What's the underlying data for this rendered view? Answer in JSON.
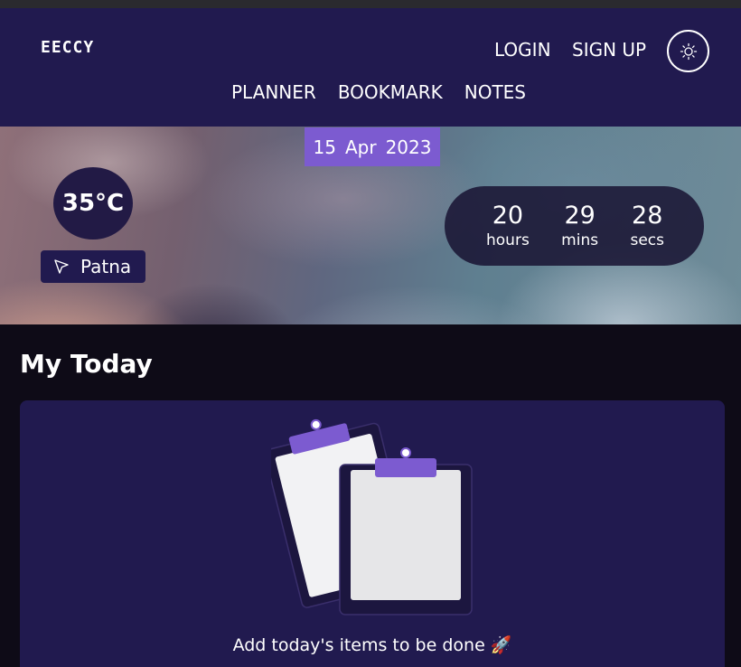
{
  "app": {
    "name": "EECCY"
  },
  "nav": {
    "login": "LOGIN",
    "signup": "SIGN UP",
    "links": [
      "PLANNER",
      "BOOKMARK",
      "NOTES"
    ],
    "theme_icon": "sun-icon"
  },
  "date": {
    "day": "15",
    "month": "Apr",
    "year": "2023"
  },
  "weather": {
    "temp": "35°C",
    "location": "Patna",
    "location_icon": "cursor-arrow-icon"
  },
  "countdown": [
    {
      "value": "20",
      "unit": "hours"
    },
    {
      "value": "29",
      "unit": "mins"
    },
    {
      "value": "28",
      "unit": "secs"
    }
  ],
  "today": {
    "title": "My Today",
    "empty_message": "Add today's items to be done",
    "empty_emoji": "🚀",
    "illustration_icon": "clipboard-icon"
  },
  "colors": {
    "navbar_bg": "#211a4f",
    "accent": "#7c5bd0",
    "page_bg": "#0e0b17"
  }
}
